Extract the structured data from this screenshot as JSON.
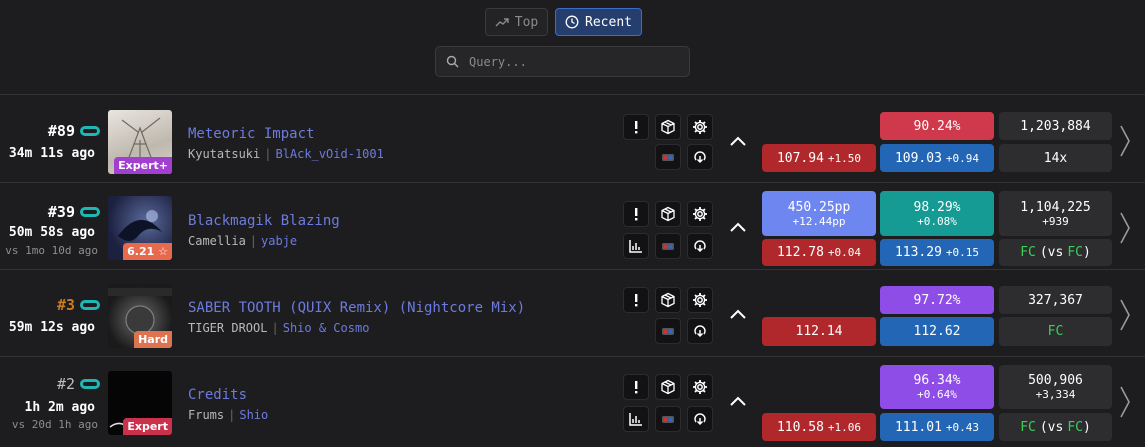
{
  "header": {
    "tabs": [
      {
        "label": "Top",
        "icon": "trending-icon"
      },
      {
        "label": "Recent",
        "icon": "clock-icon",
        "active": true
      }
    ],
    "search": {
      "placeholder": "Query..."
    }
  },
  "colors": {
    "accent": "#3d6cc7",
    "red": "#b0282b",
    "blue": "#2366b6",
    "purple": "#8f4de8",
    "teal": "#169a94",
    "fc": "#39d05a"
  },
  "scores": [
    {
      "rank": "#89",
      "ago": "34m 11s ago",
      "vs": "",
      "title": "Meteoric Impact",
      "artist": "Kyutatsuki",
      "mapper": "BlAck_vOid-1001",
      "difficulty": "Expert+",
      "left_acc": {
        "value": "107.94",
        "delta": "+1.50"
      },
      "right_acc": {
        "value": "109.03",
        "delta": "+0.94"
      },
      "accuracy": {
        "value": "90.24%",
        "delta": ""
      },
      "score": {
        "value": "1,203,884",
        "delta": ""
      },
      "misses": "14x"
    },
    {
      "rank": "#39",
      "ago": "50m 58s ago",
      "vs": "vs 1mo 10d ago",
      "title": "Blackmagik Blazing",
      "artist": "Camellia",
      "mapper": "yabje",
      "difficulty": "6.21 ☆",
      "pp": {
        "value": "450.25pp",
        "delta": "+12.44pp"
      },
      "left_acc": {
        "value": "112.78",
        "delta": "+0.04"
      },
      "right_acc": {
        "value": "113.29",
        "delta": "+0.15"
      },
      "accuracy": {
        "value": "98.29%",
        "delta": "+0.08%"
      },
      "score": {
        "value": "1,104,225",
        "delta": "+939"
      },
      "fc": {
        "a": "FC",
        "mid": "(vs",
        "b": "FC",
        "end": ")"
      }
    },
    {
      "rank": "#3",
      "ago": "59m 12s ago",
      "vs": "",
      "title": "SABER TOOTH (QUIX Remix) (Nightcore Mix)",
      "artist": "TIGER DROOL",
      "mapper": "Shio & Cosmo",
      "difficulty": "Hard",
      "left_acc": {
        "value": "112.14",
        "delta": ""
      },
      "right_acc": {
        "value": "112.62",
        "delta": ""
      },
      "accuracy": {
        "value": "97.72%",
        "delta": ""
      },
      "score": {
        "value": "327,367",
        "delta": ""
      },
      "fc_single": "FC"
    },
    {
      "rank": "#2",
      "ago": "1h 2m ago",
      "vs": "vs 20d 1h ago",
      "title": "Credits",
      "artist": "Frums",
      "mapper": "Shio",
      "difficulty": "Expert",
      "left_acc": {
        "value": "110.58",
        "delta": "+1.06"
      },
      "right_acc": {
        "value": "111.01",
        "delta": "+0.43"
      },
      "accuracy": {
        "value": "96.34%",
        "delta": "+0.64%"
      },
      "score": {
        "value": "500,906",
        "delta": "+3,334"
      },
      "fc": {
        "a": "FC",
        "mid": "(vs",
        "b": "FC",
        "end": ")"
      }
    }
  ]
}
